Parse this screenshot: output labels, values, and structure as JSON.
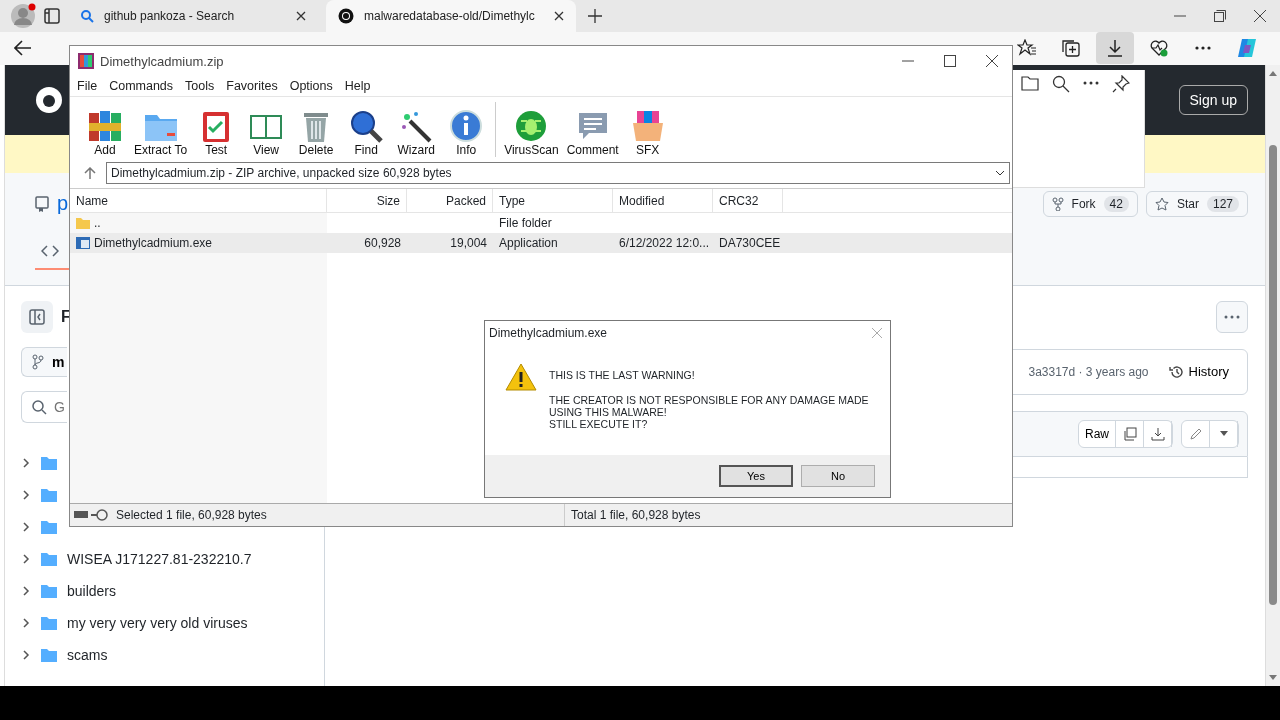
{
  "browser": {
    "tabs": [
      {
        "title": "github pankoza - Search",
        "kind": "search",
        "selected": false
      },
      {
        "title": "malwaredatabase-old/Dimethylc",
        "kind": "github",
        "selected": true
      }
    ]
  },
  "github": {
    "sign_up": "Sign up",
    "repo_title": "p",
    "fork": {
      "label": "Fork",
      "count": "42"
    },
    "star": {
      "label": "Star",
      "count": "127"
    },
    "files_heading": "F",
    "branch": "m",
    "file_search": {
      "placeholder": "G"
    },
    "tree": [
      {
        "expanded": false
      },
      {
        "expanded": false
      },
      {
        "expanded": false
      },
      {
        "name": "WISEA J171227.81-232210.7",
        "expanded": false
      },
      {
        "name": "builders",
        "expanded": false
      },
      {
        "name": "my very very very old viruses",
        "expanded": false
      },
      {
        "name": "scams",
        "expanded": false
      }
    ],
    "commit": "3a3317d · 3 years ago",
    "history": "History",
    "raw": "Raw"
  },
  "winrar": {
    "title": "Dimethylcadmium.zip",
    "menu": [
      "File",
      "Commands",
      "Tools",
      "Favorites",
      "Options",
      "Help"
    ],
    "toolbar": [
      {
        "label": "Add",
        "kind": "add"
      },
      {
        "label": "Extract To",
        "kind": "extract"
      },
      {
        "label": "Test",
        "kind": "test"
      },
      {
        "label": "View",
        "kind": "view"
      },
      {
        "label": "Delete",
        "kind": "delete"
      },
      {
        "label": "Find",
        "kind": "find"
      },
      {
        "label": "Wizard",
        "kind": "wizard"
      },
      {
        "label": "Info",
        "kind": "info"
      },
      {
        "label": "VirusScan",
        "kind": "virus"
      },
      {
        "label": "Comment",
        "kind": "comment"
      },
      {
        "label": "SFX",
        "kind": "sfx"
      }
    ],
    "address": "Dimethylcadmium.zip - ZIP archive, unpacked size 60,928 bytes",
    "columns": [
      "Name",
      "Size",
      "Packed",
      "Type",
      "Modified",
      "CRC32"
    ],
    "rows": [
      {
        "kind": "folder",
        "name": "..",
        "size": "",
        "packed": "",
        "type": "File folder",
        "modified": "",
        "crc": "",
        "selected": false
      },
      {
        "kind": "app",
        "name": "Dimethylcadmium.exe",
        "size": "60,928",
        "packed": "19,004",
        "type": "Application",
        "modified": "6/12/2022 12:0...",
        "crc": "DA730CEE",
        "selected": true
      }
    ],
    "status_left": "Selected 1 file, 60,928 bytes",
    "status_right": "Total 1 file, 60,928 bytes"
  },
  "dialog": {
    "title": "Dimethylcadmium.exe",
    "heading": "THIS IS THE LAST WARNING!",
    "lines": [
      "THE CREATOR IS NOT RESPONSIBLE FOR ANY DAMAGE MADE",
      "USING THIS MALWARE!",
      "STILL EXECUTE IT?"
    ],
    "buttons": [
      {
        "label": "Yes",
        "selected": true
      },
      {
        "label": "No",
        "selected": false
      }
    ]
  }
}
